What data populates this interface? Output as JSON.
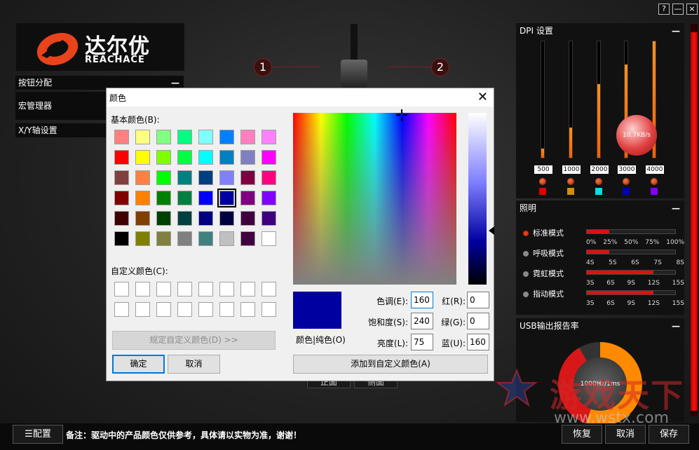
{
  "window": {
    "help": "?",
    "minimize": "—",
    "close": "×"
  },
  "brand": {
    "name_cn": "达尔优",
    "name_en": "REACHACE"
  },
  "left_menu": [
    {
      "label": "按钮分配",
      "collapse": "—"
    },
    {
      "label": "宏管理器"
    },
    {
      "label": "X/Y轴设置"
    }
  ],
  "mouse_view": {
    "badge1": "1",
    "badge2": "2",
    "btn_front": "正面",
    "btn_side": "侧面"
  },
  "dpi": {
    "title": "DPI 设置",
    "collapse": "—",
    "levels": [
      {
        "label": "500",
        "fraction": 0.08,
        "color": "#e00000"
      },
      {
        "label": "1000",
        "fraction": 0.26,
        "color": "#d09000"
      },
      {
        "label": "2000",
        "fraction": 0.63,
        "color": "#00e0e0"
      },
      {
        "label": "3000",
        "fraction": 0.8,
        "color": "#0000c0"
      },
      {
        "label": "4000",
        "fraction": 1.0,
        "color": "#8000ff"
      }
    ],
    "speed": "10.7KB/s"
  },
  "lighting": {
    "title": "照明",
    "collapse": "—",
    "modes": [
      {
        "label": "标准模式",
        "selected": true,
        "fill": 0.25,
        "ticks": [
          "0%",
          "25%",
          "50%",
          "75%",
          "100%"
        ]
      },
      {
        "label": "呼吸模式",
        "selected": false,
        "fill": 0.25,
        "ticks": [
          "4S",
          "5S",
          "6S",
          "7S",
          "8S"
        ]
      },
      {
        "label": "霓虹模式",
        "selected": false,
        "fill": 0.75,
        "ticks": [
          "3S",
          "6S",
          "9S",
          "12S",
          "15S"
        ]
      },
      {
        "label": "指动模式",
        "selected": false,
        "fill": 0.75,
        "ticks": [
          "3S",
          "6S",
          "9S",
          "12S",
          "15S"
        ]
      }
    ]
  },
  "usb": {
    "title": "USB输出报告率",
    "collapse": "—",
    "rate": "1000Hz/1ms"
  },
  "bottom": {
    "config_btn": "☰配置",
    "notice": "备注：驱动中的产品颜色仅供参考，具体请以实物为准，谢谢！",
    "restore": "恢复",
    "cancel": "取消",
    "save": "保存"
  },
  "watermark": {
    "cn": "游戏天下",
    "url": "www.wstx.com"
  },
  "color_dialog": {
    "title": "颜色",
    "close": "✕",
    "basic_label": "基本颜色(B):",
    "basic_colors": [
      "#ff8080",
      "#ffff80",
      "#80ff80",
      "#00ff80",
      "#80ffff",
      "#0080ff",
      "#ff80c0",
      "#ff80ff",
      "#ff0000",
      "#ffff00",
      "#80ff00",
      "#00ff40",
      "#00ffff",
      "#0080c0",
      "#8080c0",
      "#ff00ff",
      "#804040",
      "#ff8040",
      "#00ff00",
      "#008080",
      "#004080",
      "#8080ff",
      "#800040",
      "#ff0080",
      "#800000",
      "#ff8000",
      "#008000",
      "#008040",
      "#0000ff",
      "#0000a0",
      "#800080",
      "#8000ff",
      "#400000",
      "#804000",
      "#004000",
      "#004040",
      "#000080",
      "#000040",
      "#400040",
      "#400080",
      "#000000",
      "#808000",
      "#808040",
      "#808080",
      "#408080",
      "#c0c0c0",
      "#400040",
      "#ffffff"
    ],
    "selected_index": 29,
    "custom_label": "自定义颜色(C):",
    "define_custom": "规定自定义颜色(D) >>",
    "ok": "确定",
    "cancel": "取消",
    "preview_label": "颜色|纯色(O)",
    "add_custom": "添加到自定义颜色(A)",
    "hue_label": "色调(E):",
    "hue": "160",
    "sat_label": "饱和度(S):",
    "sat": "240",
    "lum_label": "亮度(L):",
    "lum": "75",
    "red_label": "红(R):",
    "red": "0",
    "green_label": "绿(G):",
    "green": "0",
    "blue_label": "蓝(U):",
    "blue": "160",
    "preview_color": "#0000a0"
  }
}
